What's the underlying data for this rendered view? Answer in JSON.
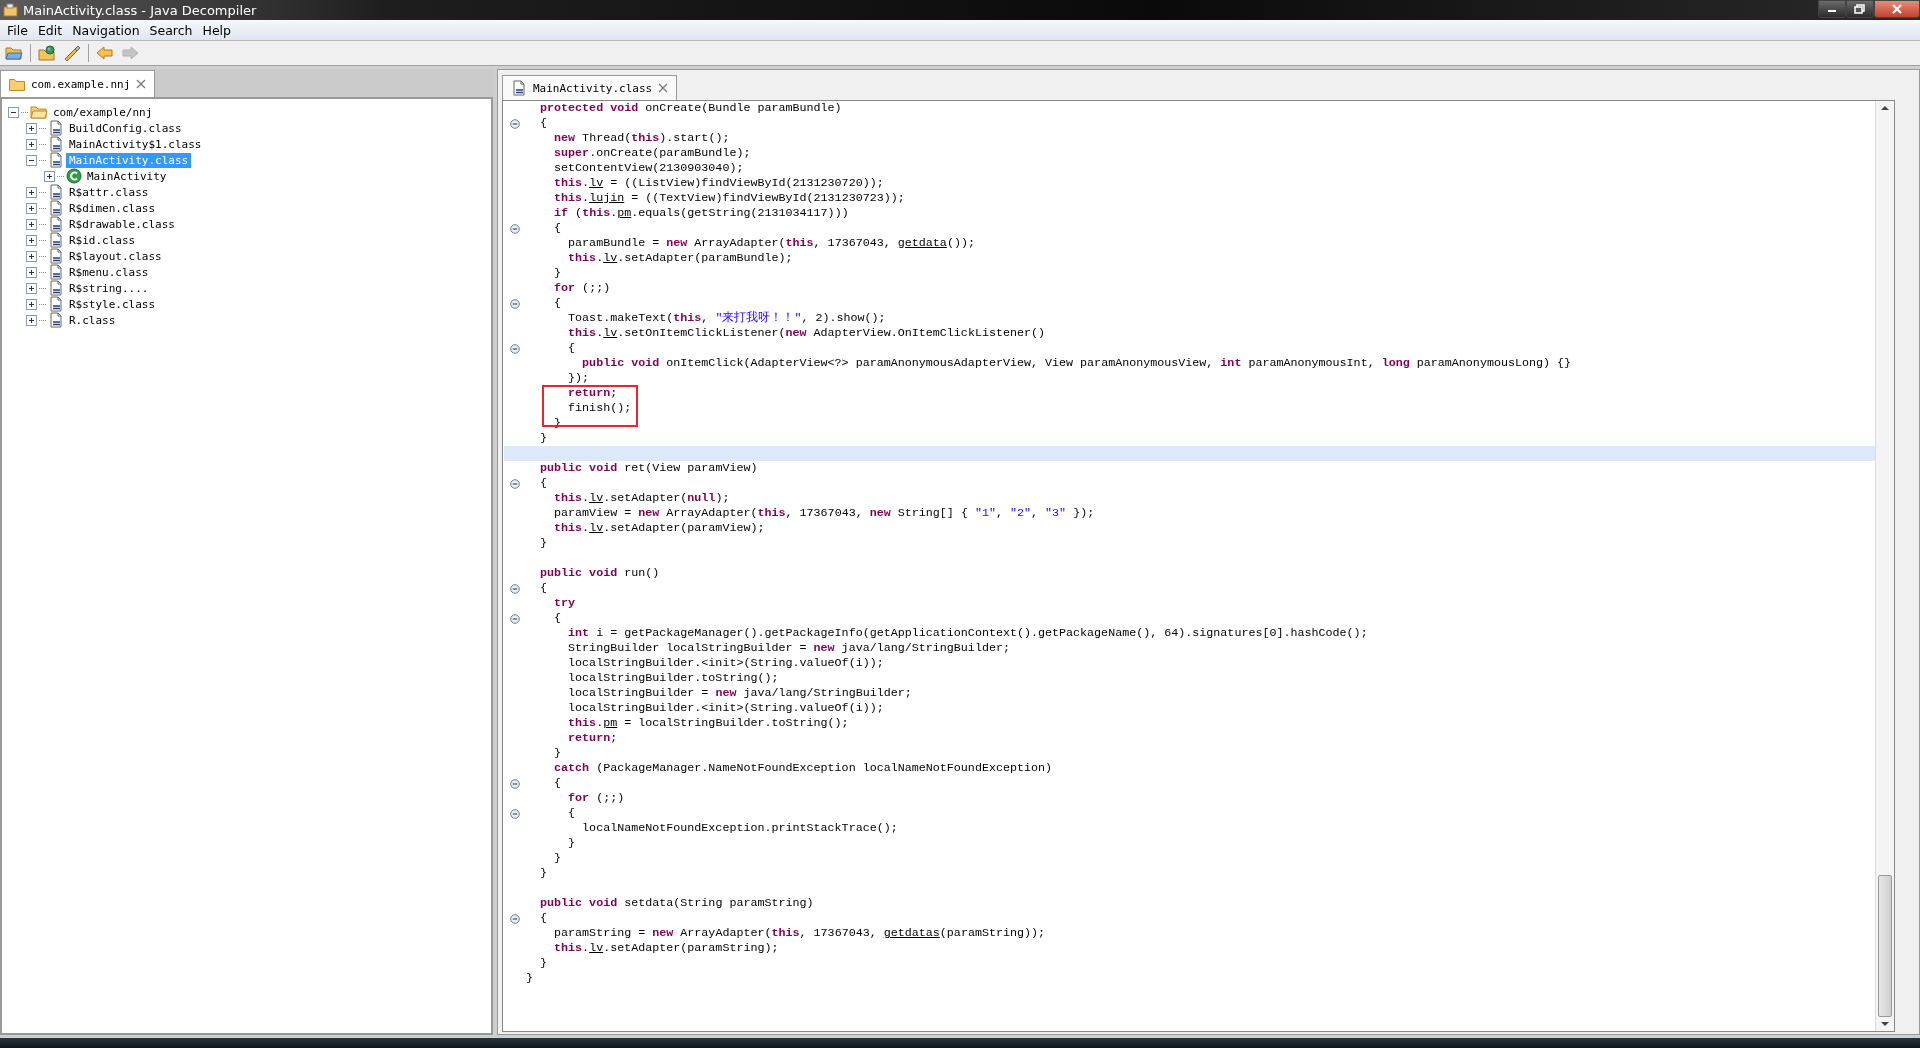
{
  "window": {
    "title": "MainActivity.class - Java Decompiler"
  },
  "menu": [
    "File",
    "Edit",
    "Navigation",
    "Search",
    "Help"
  ],
  "toolbar": [
    {
      "kind": "open",
      "disabled": false
    },
    {
      "kind": "sep"
    },
    {
      "kind": "open-type",
      "disabled": false
    },
    {
      "kind": "wand",
      "disabled": false
    },
    {
      "kind": "sep"
    },
    {
      "kind": "back",
      "disabled": false
    },
    {
      "kind": "forward",
      "disabled": true
    }
  ],
  "left_tab": {
    "label": "com.example.nnj"
  },
  "tree": [
    {
      "label": "com/example/nnj",
      "kind": "package",
      "expanded": true,
      "selected": false,
      "children": [
        {
          "label": "BuildConfig.class",
          "kind": "class",
          "expanded": false,
          "selected": false
        },
        {
          "label": "MainActivity$1.class",
          "kind": "class",
          "expanded": false,
          "selected": false
        },
        {
          "label": "MainActivity.class",
          "kind": "class",
          "expanded": true,
          "selected": true,
          "children": [
            {
              "label": "MainActivity",
              "kind": "type",
              "expanded": false,
              "selected": false
            }
          ]
        },
        {
          "label": "R$attr.class",
          "kind": "class",
          "expanded": false,
          "selected": false
        },
        {
          "label": "R$dimen.class",
          "kind": "class",
          "expanded": false,
          "selected": false
        },
        {
          "label": "R$drawable.class",
          "kind": "class",
          "expanded": false,
          "selected": false
        },
        {
          "label": "R$id.class",
          "kind": "class",
          "expanded": false,
          "selected": false
        },
        {
          "label": "R$layout.class",
          "kind": "class",
          "expanded": false,
          "selected": false
        },
        {
          "label": "R$menu.class",
          "kind": "class",
          "expanded": false,
          "selected": false
        },
        {
          "label": "R$string....",
          "kind": "class",
          "expanded": false,
          "selected": false
        },
        {
          "label": "R$style.class",
          "kind": "class",
          "expanded": false,
          "selected": false
        },
        {
          "label": "R.class",
          "kind": "class",
          "expanded": false,
          "selected": false
        }
      ]
    }
  ],
  "editor": {
    "tab": {
      "label": "MainActivity.class"
    },
    "lines": [
      {
        "fold": false,
        "current": false,
        "boxed": false,
        "tokens": [
          {
            "kind": "keyword",
            "text": "  protected void"
          },
          {
            "kind": "plain",
            "text": " onCreate(Bundle paramBundle)"
          }
        ]
      },
      {
        "fold": true,
        "current": false,
        "boxed": false,
        "tokens": [
          {
            "kind": "plain",
            "text": "  {"
          }
        ]
      },
      {
        "fold": false,
        "current": false,
        "boxed": false,
        "tokens": [
          {
            "kind": "keyword",
            "text": "    new"
          },
          {
            "kind": "plain",
            "text": " Thread("
          },
          {
            "kind": "keyword",
            "text": "this"
          },
          {
            "kind": "plain",
            "text": ").start();"
          }
        ]
      },
      {
        "fold": false,
        "current": false,
        "boxed": false,
        "tokens": [
          {
            "kind": "keyword",
            "text": "    super"
          },
          {
            "kind": "plain",
            "text": ".onCreate(paramBundle);"
          }
        ]
      },
      {
        "fold": false,
        "current": false,
        "boxed": false,
        "tokens": [
          {
            "kind": "plain",
            "text": "    setContentView(2130903040);"
          }
        ]
      },
      {
        "fold": false,
        "current": false,
        "boxed": false,
        "tokens": [
          {
            "kind": "keyword",
            "text": "    this"
          },
          {
            "kind": "plain",
            "text": "."
          },
          {
            "kind": "field",
            "text": "lv"
          },
          {
            "kind": "plain",
            "text": " = ((ListView)findViewById(2131230720));"
          }
        ]
      },
      {
        "fold": false,
        "current": false,
        "boxed": false,
        "tokens": [
          {
            "kind": "keyword",
            "text": "    this"
          },
          {
            "kind": "plain",
            "text": "."
          },
          {
            "kind": "field",
            "text": "lujin"
          },
          {
            "kind": "plain",
            "text": " = ((TextView)findViewById(2131230723));"
          }
        ]
      },
      {
        "fold": false,
        "current": false,
        "boxed": false,
        "tokens": [
          {
            "kind": "keyword",
            "text": "    if"
          },
          {
            "kind": "plain",
            "text": " ("
          },
          {
            "kind": "keyword",
            "text": "this"
          },
          {
            "kind": "plain",
            "text": "."
          },
          {
            "kind": "field",
            "text": "pm"
          },
          {
            "kind": "plain",
            "text": ".equals(getString(2131034117)))"
          }
        ]
      },
      {
        "fold": true,
        "current": false,
        "boxed": false,
        "tokens": [
          {
            "kind": "plain",
            "text": "    {"
          }
        ]
      },
      {
        "fold": false,
        "current": false,
        "boxed": false,
        "tokens": [
          {
            "kind": "plain",
            "text": "      paramBundle = "
          },
          {
            "kind": "keyword",
            "text": "new"
          },
          {
            "kind": "plain",
            "text": " ArrayAdapter("
          },
          {
            "kind": "keyword",
            "text": "this"
          },
          {
            "kind": "plain",
            "text": ", 17367043, "
          },
          {
            "kind": "field",
            "text": "getdata"
          },
          {
            "kind": "plain",
            "text": "());"
          }
        ]
      },
      {
        "fold": false,
        "current": false,
        "boxed": false,
        "tokens": [
          {
            "kind": "keyword",
            "text": "      this"
          },
          {
            "kind": "plain",
            "text": "."
          },
          {
            "kind": "field",
            "text": "lv"
          },
          {
            "kind": "plain",
            "text": ".setAdapter(paramBundle);"
          }
        ]
      },
      {
        "fold": false,
        "current": false,
        "boxed": false,
        "tokens": [
          {
            "kind": "plain",
            "text": "    }"
          }
        ]
      },
      {
        "fold": false,
        "current": false,
        "boxed": false,
        "tokens": [
          {
            "kind": "keyword",
            "text": "    for"
          },
          {
            "kind": "plain",
            "text": " (;;)"
          }
        ]
      },
      {
        "fold": true,
        "current": false,
        "boxed": false,
        "tokens": [
          {
            "kind": "plain",
            "text": "    {"
          }
        ]
      },
      {
        "fold": false,
        "current": false,
        "boxed": false,
        "tokens": [
          {
            "kind": "plain",
            "text": "      Toast.makeText("
          },
          {
            "kind": "keyword",
            "text": "this"
          },
          {
            "kind": "plain",
            "text": ", "
          },
          {
            "kind": "string",
            "text": "\"来打我呀！！\""
          },
          {
            "kind": "plain",
            "text": ", 2).show();"
          }
        ]
      },
      {
        "fold": false,
        "current": false,
        "boxed": false,
        "tokens": [
          {
            "kind": "keyword",
            "text": "      this"
          },
          {
            "kind": "plain",
            "text": "."
          },
          {
            "kind": "field",
            "text": "lv"
          },
          {
            "kind": "plain",
            "text": ".setOnItemClickListener("
          },
          {
            "kind": "keyword",
            "text": "new"
          },
          {
            "kind": "plain",
            "text": " AdapterView.OnItemClickListener()"
          }
        ]
      },
      {
        "fold": true,
        "current": false,
        "boxed": false,
        "tokens": [
          {
            "kind": "plain",
            "text": "      {"
          }
        ]
      },
      {
        "fold": false,
        "current": false,
        "boxed": false,
        "tokens": [
          {
            "kind": "keyword",
            "text": "        public void"
          },
          {
            "kind": "plain",
            "text": " onItemClick(AdapterView<?> paramAnonymousAdapterView, View paramAnonymousView, "
          },
          {
            "kind": "keyword",
            "text": "int"
          },
          {
            "kind": "plain",
            "text": " paramAnonymousInt, "
          },
          {
            "kind": "keyword",
            "text": "long"
          },
          {
            "kind": "plain",
            "text": " paramAnonymousLong) {}"
          }
        ]
      },
      {
        "fold": false,
        "current": false,
        "boxed": false,
        "tokens": [
          {
            "kind": "plain",
            "text": "      });"
          }
        ]
      },
      {
        "fold": false,
        "current": false,
        "boxed": true,
        "tokens": [
          {
            "kind": "keyword",
            "text": "      return"
          },
          {
            "kind": "plain",
            "text": ";"
          }
        ]
      },
      {
        "fold": false,
        "current": false,
        "boxed": true,
        "tokens": [
          {
            "kind": "plain",
            "text": "      finish();"
          }
        ]
      },
      {
        "fold": false,
        "current": false,
        "boxed": false,
        "tokens": [
          {
            "kind": "plain",
            "text": "    }"
          }
        ]
      },
      {
        "fold": false,
        "current": false,
        "boxed": false,
        "tokens": [
          {
            "kind": "plain",
            "text": "  }"
          }
        ]
      },
      {
        "fold": false,
        "current": true,
        "boxed": false
      },
      {
        "fold": false,
        "current": false,
        "boxed": false,
        "tokens": [
          {
            "kind": "keyword",
            "text": "  public void"
          },
          {
            "kind": "plain",
            "text": " ret(View paramView)"
          }
        ]
      },
      {
        "fold": true,
        "current": false,
        "boxed": false,
        "tokens": [
          {
            "kind": "plain",
            "text": "  {"
          }
        ]
      },
      {
        "fold": false,
        "current": false,
        "boxed": false,
        "tokens": [
          {
            "kind": "keyword",
            "text": "    this"
          },
          {
            "kind": "plain",
            "text": "."
          },
          {
            "kind": "field",
            "text": "lv"
          },
          {
            "kind": "plain",
            "text": ".setAdapter("
          },
          {
            "kind": "keyword",
            "text": "null"
          },
          {
            "kind": "plain",
            "text": ");"
          }
        ]
      },
      {
        "fold": false,
        "current": false,
        "boxed": false,
        "tokens": [
          {
            "kind": "plain",
            "text": "    paramView = "
          },
          {
            "kind": "keyword",
            "text": "new"
          },
          {
            "kind": "plain",
            "text": " ArrayAdapter("
          },
          {
            "kind": "keyword",
            "text": "this"
          },
          {
            "kind": "plain",
            "text": ", 17367043, "
          },
          {
            "kind": "keyword",
            "text": "new"
          },
          {
            "kind": "plain",
            "text": " String[] { "
          },
          {
            "kind": "string",
            "text": "\"1\""
          },
          {
            "kind": "plain",
            "text": ", "
          },
          {
            "kind": "string",
            "text": "\"2\""
          },
          {
            "kind": "plain",
            "text": ", "
          },
          {
            "kind": "string",
            "text": "\"3\""
          },
          {
            "kind": "plain",
            "text": " });"
          }
        ]
      },
      {
        "fold": false,
        "current": false,
        "boxed": false,
        "tokens": [
          {
            "kind": "keyword",
            "text": "    this"
          },
          {
            "kind": "plain",
            "text": "."
          },
          {
            "kind": "field",
            "text": "lv"
          },
          {
            "kind": "plain",
            "text": ".setAdapter(paramView);"
          }
        ]
      },
      {
        "fold": false,
        "current": false,
        "boxed": false,
        "tokens": [
          {
            "kind": "plain",
            "text": "  }"
          }
        ]
      },
      {
        "fold": false,
        "current": false,
        "boxed": false
      },
      {
        "fold": false,
        "current": false,
        "boxed": false,
        "tokens": [
          {
            "kind": "keyword",
            "text": "  public void"
          },
          {
            "kind": "plain",
            "text": " run()"
          }
        ]
      },
      {
        "fold": true,
        "current": false,
        "boxed": false,
        "tokens": [
          {
            "kind": "plain",
            "text": "  {"
          }
        ]
      },
      {
        "fold": false,
        "current": false,
        "boxed": false,
        "tokens": [
          {
            "kind": "keyword",
            "text": "    try"
          }
        ]
      },
      {
        "fold": true,
        "current": false,
        "boxed": false,
        "tokens": [
          {
            "kind": "plain",
            "text": "    {"
          }
        ]
      },
      {
        "fold": false,
        "current": false,
        "boxed": false,
        "tokens": [
          {
            "kind": "keyword",
            "text": "      int"
          },
          {
            "kind": "plain",
            "text": " i = getPackageManager().getPackageInfo(getApplicationContext().getPackageName(), 64).signatures[0].hashCode();"
          }
        ]
      },
      {
        "fold": false,
        "current": false,
        "boxed": false,
        "tokens": [
          {
            "kind": "plain",
            "text": "      StringBuilder localStringBuilder = "
          },
          {
            "kind": "keyword",
            "text": "new"
          },
          {
            "kind": "plain",
            "text": " java/lang/StringBuilder;"
          }
        ]
      },
      {
        "fold": false,
        "current": false,
        "boxed": false,
        "tokens": [
          {
            "kind": "plain",
            "text": "      localStringBuilder.<init>(String.valueOf(i));"
          }
        ]
      },
      {
        "fold": false,
        "current": false,
        "boxed": false,
        "tokens": [
          {
            "kind": "plain",
            "text": "      localStringBuilder.toString();"
          }
        ]
      },
      {
        "fold": false,
        "current": false,
        "boxed": false,
        "tokens": [
          {
            "kind": "plain",
            "text": "      localStringBuilder = "
          },
          {
            "kind": "keyword",
            "text": "new"
          },
          {
            "kind": "plain",
            "text": " java/lang/StringBuilder;"
          }
        ]
      },
      {
        "fold": false,
        "current": false,
        "boxed": false,
        "tokens": [
          {
            "kind": "plain",
            "text": "      localStringBuilder.<init>(String.valueOf(i));"
          }
        ]
      },
      {
        "fold": false,
        "current": false,
        "boxed": false,
        "tokens": [
          {
            "kind": "keyword",
            "text": "      this"
          },
          {
            "kind": "plain",
            "text": "."
          },
          {
            "kind": "field",
            "text": "pm"
          },
          {
            "kind": "plain",
            "text": " = localStringBuilder.toString();"
          }
        ]
      },
      {
        "fold": false,
        "current": false,
        "boxed": false,
        "tokens": [
          {
            "kind": "keyword",
            "text": "      return"
          },
          {
            "kind": "plain",
            "text": ";"
          }
        ]
      },
      {
        "fold": false,
        "current": false,
        "boxed": false,
        "tokens": [
          {
            "kind": "plain",
            "text": "    }"
          }
        ]
      },
      {
        "fold": false,
        "current": false,
        "boxed": false,
        "tokens": [
          {
            "kind": "keyword",
            "text": "    catch"
          },
          {
            "kind": "plain",
            "text": " (PackageManager.NameNotFoundException localNameNotFoundException)"
          }
        ]
      },
      {
        "fold": true,
        "current": false,
        "boxed": false,
        "tokens": [
          {
            "kind": "plain",
            "text": "    {"
          }
        ]
      },
      {
        "fold": false,
        "current": false,
        "boxed": false,
        "tokens": [
          {
            "kind": "keyword",
            "text": "      for"
          },
          {
            "kind": "plain",
            "text": " (;;)"
          }
        ]
      },
      {
        "fold": true,
        "current": false,
        "boxed": false,
        "tokens": [
          {
            "kind": "plain",
            "text": "      {"
          }
        ]
      },
      {
        "fold": false,
        "current": false,
        "boxed": false,
        "tokens": [
          {
            "kind": "plain",
            "text": "        localNameNotFoundException.printStackTrace();"
          }
        ]
      },
      {
        "fold": false,
        "current": false,
        "boxed": false,
        "tokens": [
          {
            "kind": "plain",
            "text": "      }"
          }
        ]
      },
      {
        "fold": false,
        "current": false,
        "boxed": false,
        "tokens": [
          {
            "kind": "plain",
            "text": "    }"
          }
        ]
      },
      {
        "fold": false,
        "current": false,
        "boxed": false,
        "tokens": [
          {
            "kind": "plain",
            "text": "  }"
          }
        ]
      },
      {
        "fold": false,
        "current": false,
        "boxed": false
      },
      {
        "fold": false,
        "current": false,
        "boxed": false,
        "tokens": [
          {
            "kind": "keyword",
            "text": "  public void"
          },
          {
            "kind": "plain",
            "text": " setdata(String paramString)"
          }
        ]
      },
      {
        "fold": true,
        "current": false,
        "boxed": false,
        "tokens": [
          {
            "kind": "plain",
            "text": "  {"
          }
        ]
      },
      {
        "fold": false,
        "current": false,
        "boxed": false,
        "tokens": [
          {
            "kind": "plain",
            "text": "    paramString = "
          },
          {
            "kind": "keyword",
            "text": "new"
          },
          {
            "kind": "plain",
            "text": " ArrayAdapter("
          },
          {
            "kind": "keyword",
            "text": "this"
          },
          {
            "kind": "plain",
            "text": ", 17367043, "
          },
          {
            "kind": "field",
            "text": "getdatas"
          },
          {
            "kind": "plain",
            "text": "(paramString));"
          }
        ]
      },
      {
        "fold": false,
        "current": false,
        "boxed": false,
        "tokens": [
          {
            "kind": "keyword",
            "text": "    this"
          },
          {
            "kind": "plain",
            "text": "."
          },
          {
            "kind": "field",
            "text": "lv"
          },
          {
            "kind": "plain",
            "text": ".setAdapter(paramString);"
          }
        ]
      },
      {
        "fold": false,
        "current": false,
        "boxed": false,
        "tokens": [
          {
            "kind": "plain",
            "text": "  }"
          }
        ]
      },
      {
        "fold": false,
        "current": false,
        "boxed": false,
        "tokens": [
          {
            "kind": "plain",
            "text": "}"
          }
        ]
      }
    ]
  }
}
